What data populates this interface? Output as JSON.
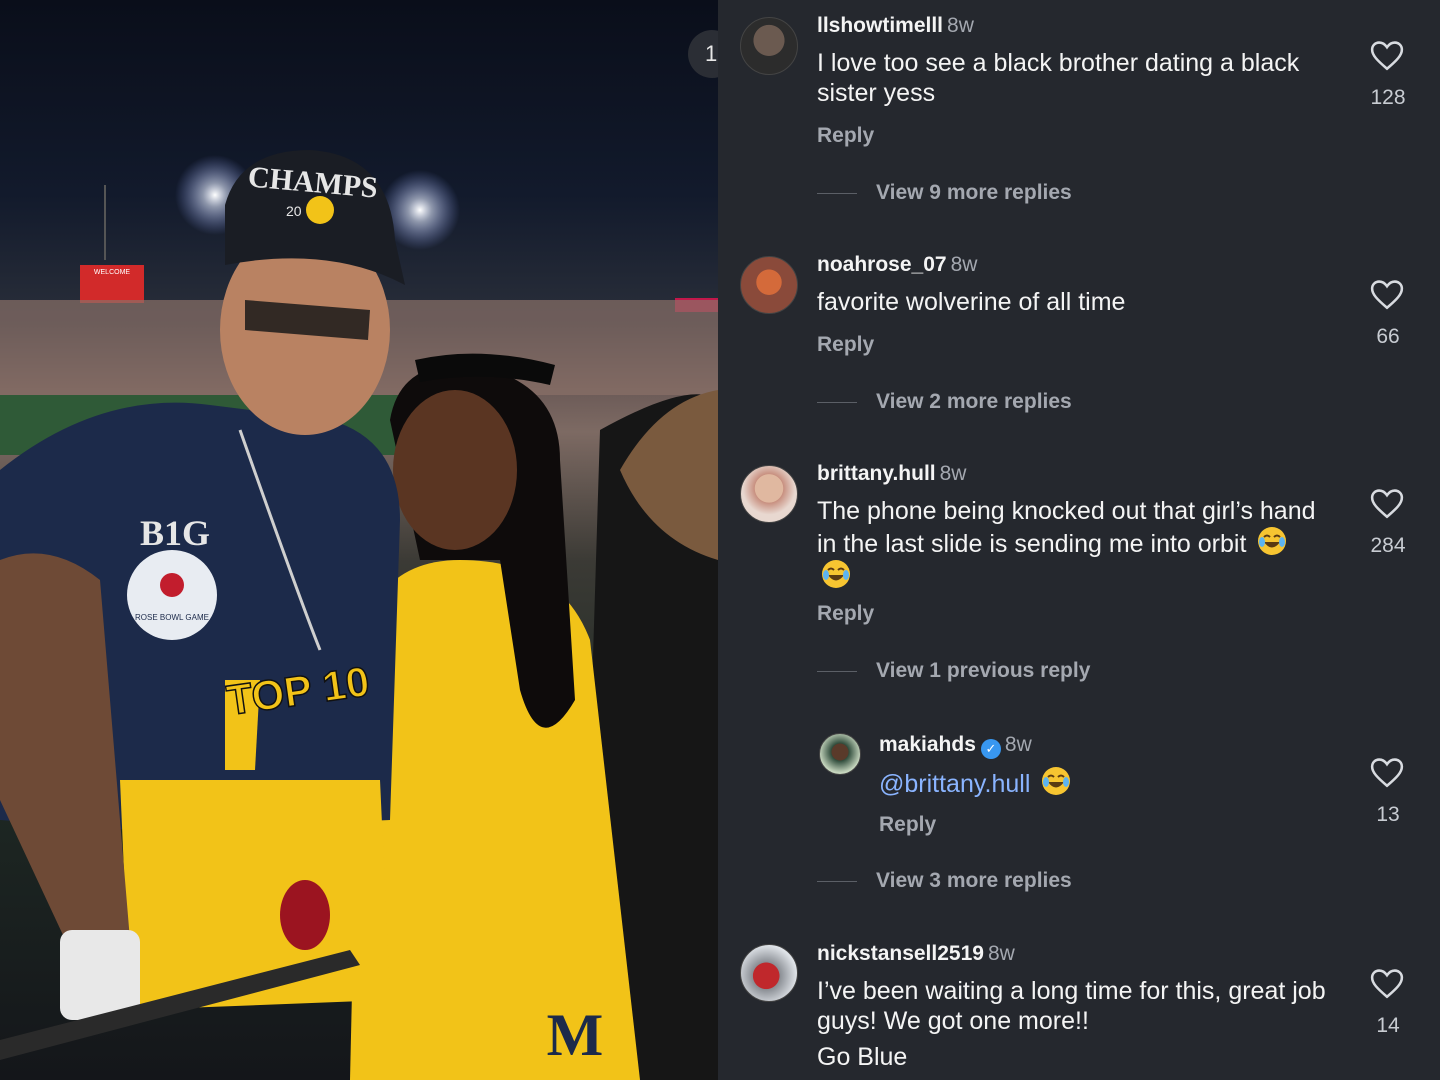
{
  "photo": {
    "badge": "1",
    "cap_text": "CHAMPS",
    "cap_year": "20",
    "jersey_logo": "B1G",
    "patch_text": "ROSE BOWL GAME",
    "chain_text": "TOP 10",
    "scoreboard_text": "WELCOME",
    "jacket_logo": "M"
  },
  "comments": [
    {
      "username": "llshowtimelll",
      "time": "8w",
      "text": "I love too see a black brother dating a black sister yess",
      "reply_label": "Reply",
      "likes": "128",
      "more_replies": "View 9 more replies",
      "avatar": "profile-photo"
    },
    {
      "username": "noahrose_07",
      "time": "8w",
      "text": "favorite wolverine of all time",
      "reply_label": "Reply",
      "likes": "66",
      "more_replies": "View 2 more replies",
      "avatar": "profile-photo"
    },
    {
      "username": "brittany.hull",
      "time": "8w",
      "text": "The phone being knocked out that girl’s hand in the last slide is sending me into orbit",
      "emoji": [
        "face-with-tears-of-joy",
        "face-with-tears-of-joy"
      ],
      "reply_label": "Reply",
      "likes": "284",
      "previous_reply": "View 1 previous reply",
      "avatar": "profile-photo"
    },
    {
      "username": "makiahds",
      "verified": true,
      "time": "8w",
      "mention": "@brittany.hull",
      "emoji": [
        "face-with-tears-of-joy"
      ],
      "reply_label": "Reply",
      "likes": "13",
      "more_replies": "View 3 more replies",
      "avatar": "profile-photo"
    },
    {
      "username": "nickstansell2519",
      "time": "8w",
      "text_line1": "I’ve been waiting a long time for this, great job guys! We got one more!!",
      "text_line2": "Go Blue",
      "likes": "14",
      "avatar": "profile-photo"
    }
  ],
  "colors": {
    "panel_bg": "#25282e",
    "text": "#f4f4f4",
    "muted": "#a4a8b0",
    "mention": "#8ab4ff",
    "verified": "#3897f0",
    "maize": "#f2c318",
    "navy": "#1c2a4a"
  }
}
